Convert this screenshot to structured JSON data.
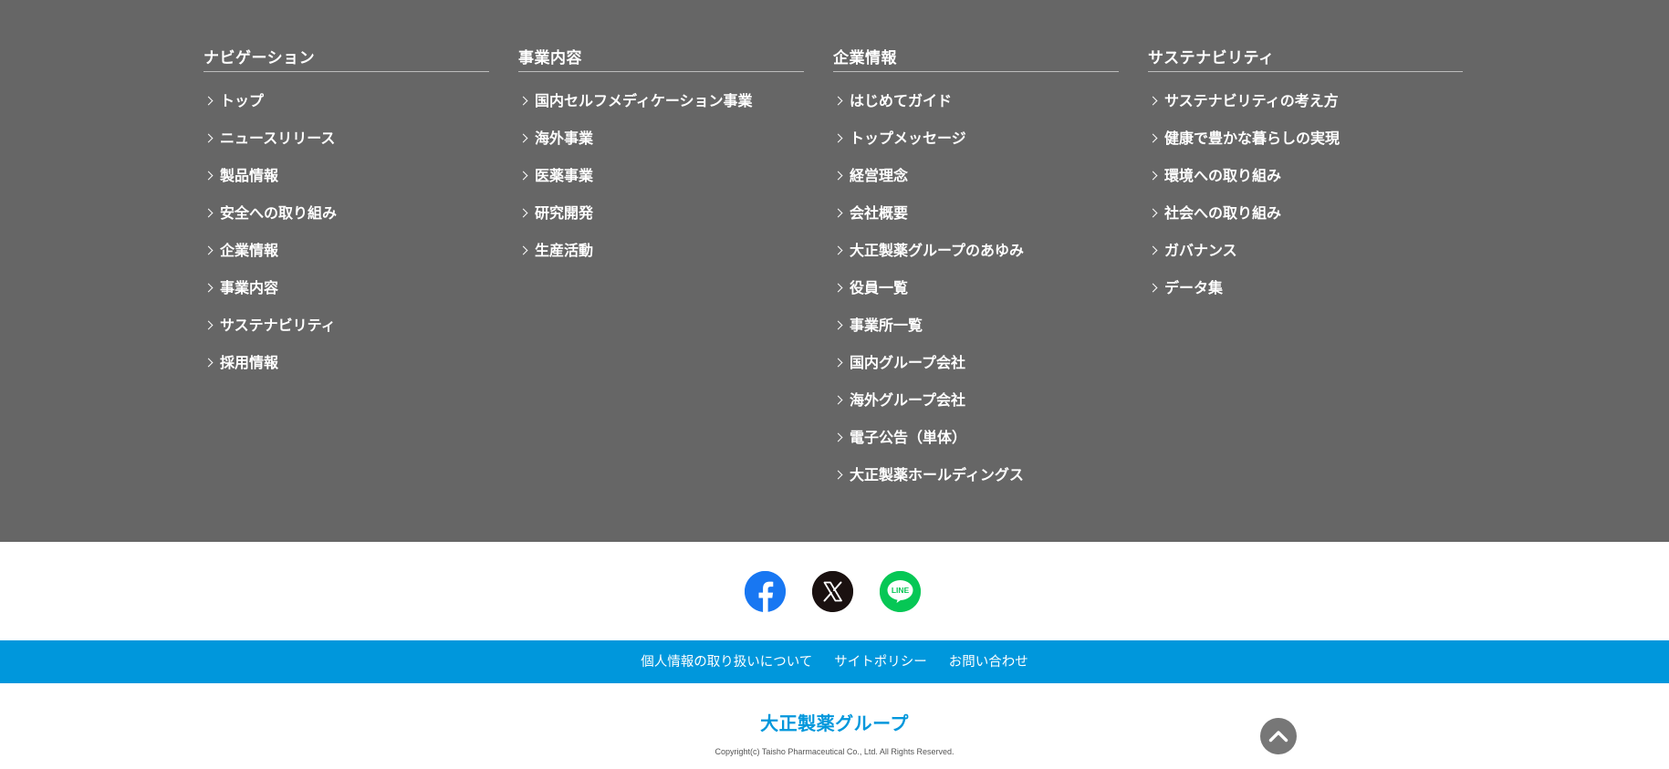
{
  "footer_nav": {
    "columns": [
      {
        "title": "ナビゲーション",
        "links": [
          "トップ",
          "ニュースリリース",
          "製品情報",
          "安全への取り組み",
          "企業情報",
          "事業内容",
          "サステナビリティ",
          "採用情報"
        ]
      },
      {
        "title": "事業内容",
        "links": [
          "国内セルフメディケーション事業",
          "海外事業",
          "医薬事業",
          "研究開発",
          "生産活動"
        ]
      },
      {
        "title": "企業情報",
        "links": [
          "はじめてガイド",
          "トップメッセージ",
          "経営理念",
          "会社概要",
          "大正製薬グループのあゆみ",
          "役員一覧",
          "事業所一覧",
          "国内グループ会社",
          "海外グループ会社",
          "電子公告（単体）",
          "大正製薬ホールディングス"
        ]
      },
      {
        "title": "サステナビリティ",
        "links": [
          "サステナビリティの考え方",
          "健康で豊かな暮らしの実現",
          "環境への取り組み",
          "社会への取り組み",
          "ガバナンス",
          "データ集"
        ]
      }
    ]
  },
  "social": {
    "facebook_color": "#1877f2",
    "x_color": "#1a1110",
    "line_color": "#06c755",
    "line_label": "LINE"
  },
  "policy_bar": {
    "links": [
      "個人情報の取り扱いについて",
      "サイトポリシー",
      "お問い合わせ"
    ],
    "color": "#0097dc"
  },
  "bottom": {
    "brand": "大正製薬グループ",
    "copyright": "Copyright(c) Taisho Pharmaceutical Co., Ltd. All Rights Reserved."
  }
}
